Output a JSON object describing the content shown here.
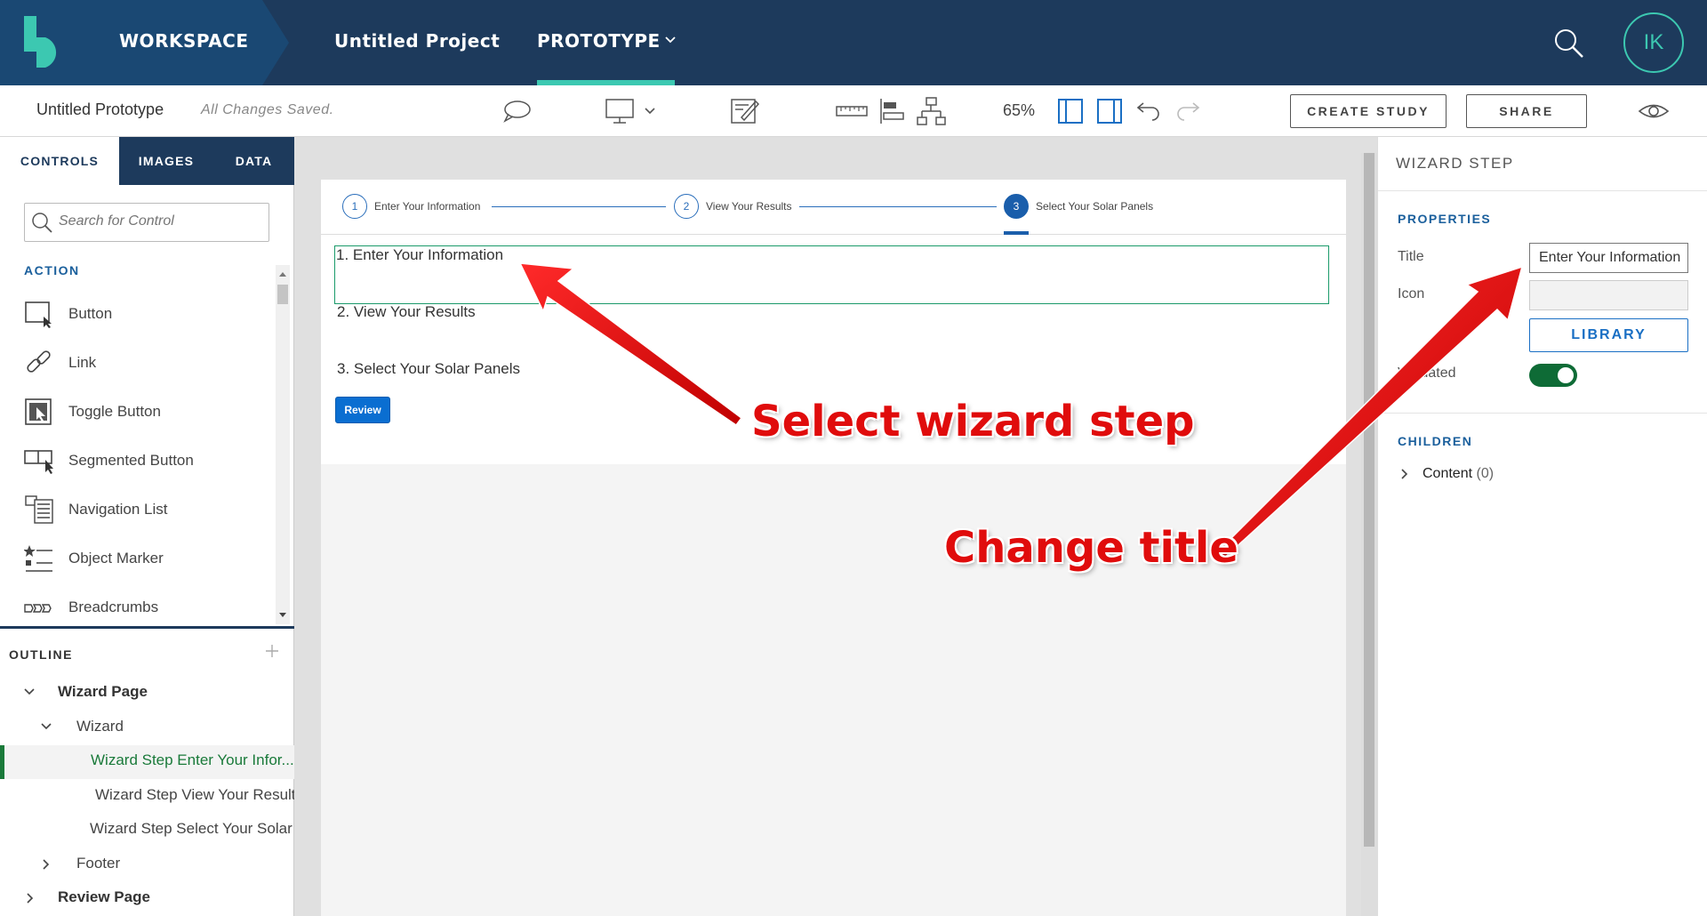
{
  "topbar": {
    "workspace_label": "WORKSPACE",
    "project_label": "Untitled Project",
    "prototype_label": "PROTOTYPE",
    "avatar_initials": "IK"
  },
  "toolbar": {
    "doc_title": "Untitled Prototype",
    "save_status": "All Changes Saved.",
    "zoom": "65%",
    "create_study_label": "CREATE STUDY",
    "share_label": "SHARE"
  },
  "left_panel": {
    "tabs": [
      {
        "label": "CONTROLS"
      },
      {
        "label": "IMAGES"
      },
      {
        "label": "DATA"
      }
    ],
    "search_placeholder": "Search for Control",
    "section_action": "ACTION",
    "controls": [
      {
        "label": "Button",
        "icon": "button-icon"
      },
      {
        "label": "Link",
        "icon": "link-icon"
      },
      {
        "label": "Toggle Button",
        "icon": "toggle-button-icon"
      },
      {
        "label": "Segmented Button",
        "icon": "segmented-button-icon"
      },
      {
        "label": "Navigation List",
        "icon": "navigation-list-icon"
      },
      {
        "label": "Object Marker",
        "icon": "object-marker-icon"
      },
      {
        "label": "Breadcrumbs",
        "icon": "breadcrumbs-icon"
      }
    ],
    "outline_title": "OUTLINE",
    "tree": [
      {
        "label": "Wizard Page"
      },
      {
        "label": "Wizard"
      },
      {
        "label": "Wizard Step Enter Your Infor..."
      },
      {
        "label": "Wizard Step View Your Results"
      },
      {
        "label": "Wizard Step Select Your Solar ..."
      },
      {
        "label": "Footer"
      },
      {
        "label": "Review Page"
      }
    ]
  },
  "canvas": {
    "wizard_steps": [
      {
        "num": "1",
        "label": "Enter Your Information"
      },
      {
        "num": "2",
        "label": "View Your Results"
      },
      {
        "num": "3",
        "label": "Select Your Solar Panels"
      }
    ],
    "step_texts": [
      "1. Enter Your Information",
      "2. View Your Results",
      "3. Select Your Solar Panels"
    ],
    "review_label": "Review"
  },
  "right_panel": {
    "title": "WIZARD STEP",
    "properties_heading": "PROPERTIES",
    "title_label": "Title",
    "title_value": "Enter Your Information",
    "icon_label": "Icon",
    "library_label": "LIBRARY",
    "validated_label": "Validated",
    "validated_on": true,
    "children_heading": "CHILDREN",
    "children_item": "Content",
    "children_count": "(0)"
  },
  "annotations": {
    "select_step": "Select wizard step",
    "change_title": "Change title"
  },
  "colors": {
    "topbar": "#1d3a5c",
    "accent_teal": "#3cc8b1",
    "link_blue": "#1a6fc4",
    "annotation_red": "#e00c0c",
    "toggle_green": "#0e6b36"
  }
}
